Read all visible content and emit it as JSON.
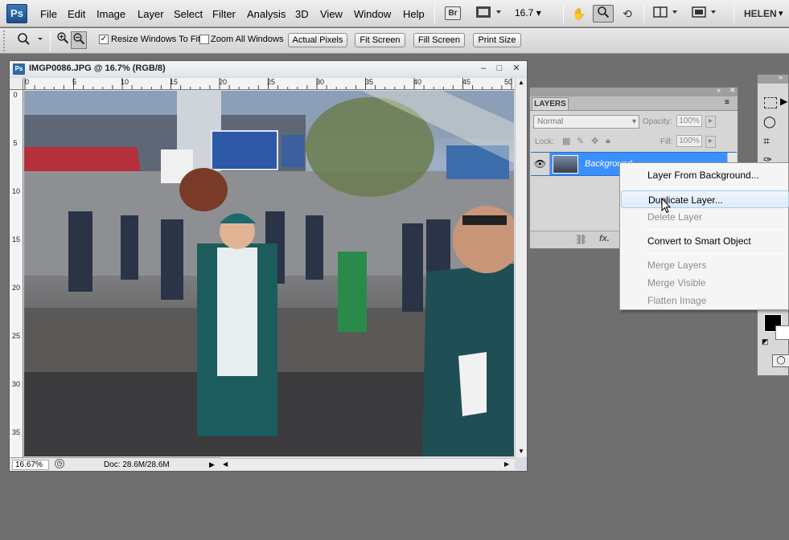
{
  "app": {
    "logo_text": "Ps",
    "menus": [
      "File",
      "Edit",
      "Image",
      "Layer",
      "Select",
      "Filter",
      "Analysis",
      "3D",
      "View",
      "Window",
      "Help"
    ],
    "bridge_label": "Br",
    "zoom_level": "16.7",
    "user_name": "HELEN"
  },
  "options_bar": {
    "resize_windows_label": "Resize Windows To Fit",
    "resize_windows_checked": true,
    "zoom_all_windows_label": "Zoom All Windows",
    "zoom_all_windows_checked": false,
    "buttons": [
      "Actual Pixels",
      "Fit Screen",
      "Fill Screen",
      "Print Size"
    ]
  },
  "document": {
    "title": "IMGP0086.JPG @ 16.7% (RGB/8)",
    "ruler_top_labels": [
      "0",
      "5",
      "10",
      "15",
      "20",
      "25",
      "30",
      "35",
      "40",
      "45",
      "50"
    ],
    "ruler_left_labels": [
      "0",
      "5",
      "10",
      "15",
      "20",
      "25",
      "30",
      "35"
    ],
    "zoom_field": "16.67%",
    "doc_info": "Doc: 28.6M/28.6M"
  },
  "layers_panel": {
    "tab_label": "LAYERS",
    "blend_mode": "Normal",
    "opacity_label": "Opacity:",
    "opacity_value": "100%",
    "lock_label": "Lock:",
    "fill_label": "Fill:",
    "fill_value": "100%",
    "layer_name": "Background",
    "bottom_icons": [
      "link-icon",
      "fx-icon"
    ]
  },
  "context_menu": {
    "items": [
      {
        "label": "Layer From Background...",
        "enabled": true,
        "hover": false
      },
      {
        "label": "Duplicate Layer...",
        "enabled": true,
        "hover": true
      },
      {
        "label": "Delete Layer",
        "enabled": false,
        "hover": false
      },
      {
        "label": "Convert to Smart Object",
        "enabled": true,
        "hover": false
      },
      {
        "label": "Merge Layers",
        "enabled": false,
        "hover": false
      },
      {
        "label": "Merge Visible",
        "enabled": false,
        "hover": false
      },
      {
        "label": "Flatten Image",
        "enabled": false,
        "hover": false
      }
    ]
  },
  "colors": {
    "accent": "#3a90ff",
    "workspace_bg": "#6f6f6f"
  }
}
